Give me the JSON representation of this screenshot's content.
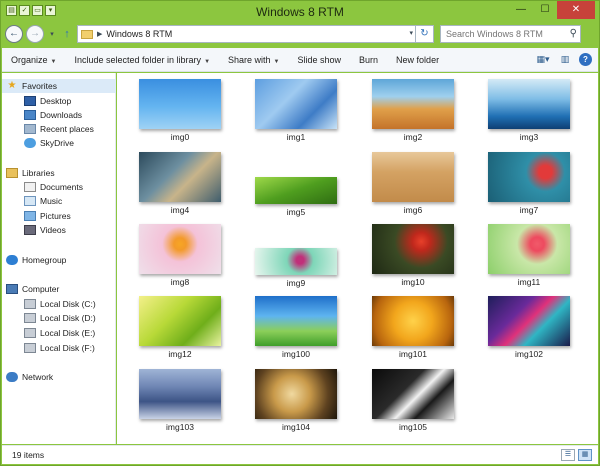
{
  "window": {
    "title": "Windows 8 RTM",
    "qat_icons": [
      "folder-icon",
      "properties-icon",
      "new-folder-icon",
      "dropdown-icon"
    ],
    "controls": {
      "minimize": "—",
      "maximize": "☐",
      "close": "✕"
    }
  },
  "address": {
    "path": "Windows 8 RTM",
    "search_placeholder": "Search Windows 8 RTM"
  },
  "toolbar": {
    "items": [
      {
        "label": "Organize",
        "has_menu": true
      },
      {
        "label": "Include selected folder in library",
        "has_menu": true
      },
      {
        "label": "Share with",
        "has_menu": true
      },
      {
        "label": "Slide show",
        "has_menu": false
      },
      {
        "label": "Burn",
        "has_menu": false
      },
      {
        "label": "New folder",
        "has_menu": false
      }
    ]
  },
  "nav": {
    "favorites": "Favorites",
    "desktop": "Desktop",
    "downloads": "Downloads",
    "recent": "Recent places",
    "skydrive": "SkyDrive",
    "libraries": "Libraries",
    "documents": "Documents",
    "music": "Music",
    "pictures": "Pictures",
    "videos": "Videos",
    "homegroup": "Homegroup",
    "computer": "Computer",
    "disk_c": "Local Disk (C:)",
    "disk_d": "Local Disk (D:)",
    "disk_e": "Local Disk (E:)",
    "disk_f": "Local Disk (F:)",
    "network": "Network"
  },
  "files": [
    {
      "name": "img0",
      "bg": "linear-gradient(180deg,#3a8fe0 0%,#64b4f0 55%,#9fd2f5 100%)"
    },
    {
      "name": "img1",
      "bg": "linear-gradient(135deg,#5d9ee0 0%,#9fcaf0 40%,#3e7cc6 70%,#c9e3f7 100%)"
    },
    {
      "name": "img2",
      "bg": "linear-gradient(180deg,#5ea6d8 0%,#9fd0ee 35%,#e0a04a 60%,#c4732a 100%)"
    },
    {
      "name": "img3",
      "bg": "linear-gradient(180deg,#d4eaf6 0%,#7fbde6 40%,#1f6fb3 75%,#0e3f74 100%)"
    },
    {
      "name": "img4",
      "bg": "linear-gradient(135deg,#2c4a5c 0%,#6d8fa0 40%,#c8b48a 60%,#3f5d6d 100%)"
    },
    {
      "name": "img5",
      "bg": "linear-gradient(160deg,#9fd94a 0%,#4f9e1f 50%,#2f6d12 100%)"
    },
    {
      "name": "img6",
      "bg": "linear-gradient(180deg,#e8c89a 0%,#d4a263 40%,#c28b4a 100%)"
    },
    {
      "name": "img7",
      "bg": "radial-gradient(circle at 70% 40%,#e23a3a 0%,#e23a3a 10%,#2f8fa8 30%,#1b5f75 100%)"
    },
    {
      "name": "img8",
      "bg": "radial-gradient(circle at 50% 40%,#f7a624 0%,#f39a2a 12%,#f4c2d8 35%,#efe0ea 100%)"
    },
    {
      "name": "img9",
      "bg": "radial-gradient(circle at 55% 45%,#c0307a 0%,#c0307a 8%,#7ed6b8 28%,#e9f6ef 100%)"
    },
    {
      "name": "img10",
      "bg": "radial-gradient(circle at 60% 35%,#e8402a 0%,#c0281c 15%,#3a4a24 45%,#1e2814 100%)"
    },
    {
      "name": "img11",
      "bg": "radial-gradient(circle at 60% 40%,#f05a6a 0%,#ee4a5f 12%,#c9e7a8 35%,#8ccf6a 100%)"
    },
    {
      "name": "img12",
      "bg": "linear-gradient(135deg,#f3f08a 0%,#b8d938 40%,#6fae1a 70%,#e9f3a0 100%)"
    },
    {
      "name": "img100",
      "bg": "linear-gradient(180deg,#1f6fc9 0%,#5eb4f0 40%,#8ccf5a 70%,#3f9e2a 100%)"
    },
    {
      "name": "img101",
      "bg": "radial-gradient(circle at 50% 50%,#ffd24a 0%,#f2a61c 40%,#b8650e 80%,#6b3a08 100%)"
    },
    {
      "name": "img102",
      "bg": "linear-gradient(135deg,#1e1e5a 0%,#6a2a9a 35%,#e0317a 50%,#2fb6c4 65%,#1a1a4a 100%)"
    },
    {
      "name": "img103",
      "bg": "linear-gradient(180deg,#9fb4d6 0%,#6f86b4 35%,#3d5486 65%,#c9d3e6 100%)"
    },
    {
      "name": "img104",
      "bg": "radial-gradient(circle at 45% 50%,#f0d9a0 0%,#c99a4a 35%,#5e4220 70%,#1e160a 100%)"
    },
    {
      "name": "img105",
      "bg": "linear-gradient(135deg,#0a0a0a 0%,#2a2a2a 40%,#f2f2f2 55%,#1a1a1a 70%,#e8e8e8 100%)"
    }
  ],
  "status": {
    "count": "19 items"
  }
}
